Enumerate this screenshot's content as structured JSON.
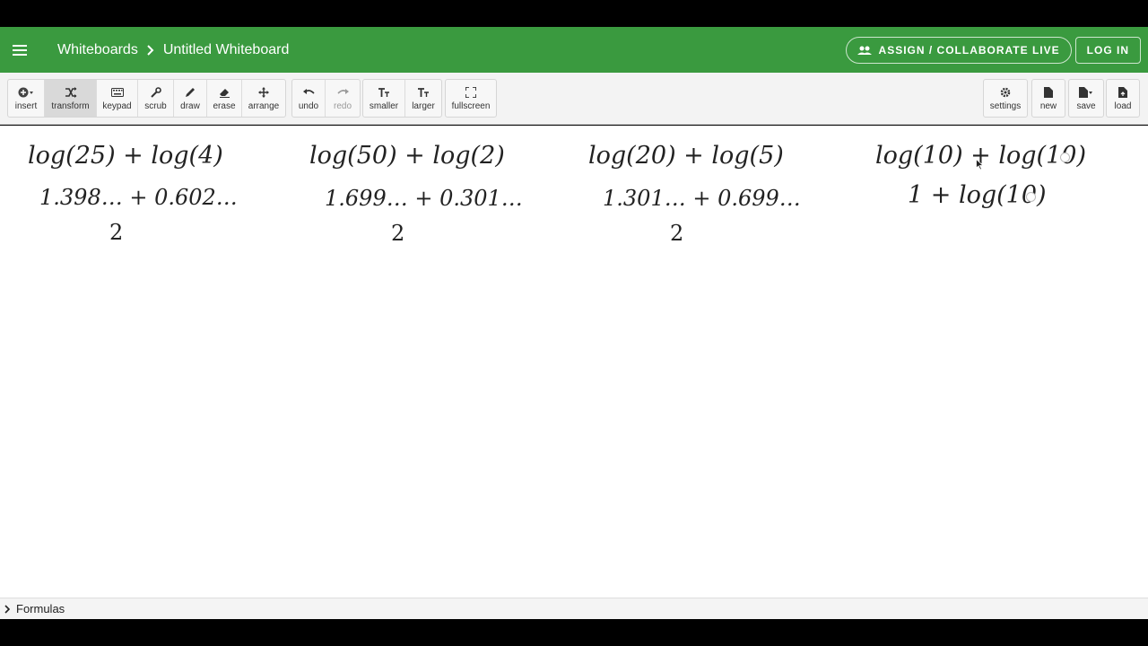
{
  "header": {
    "menu_icon": "hamburger-menu-icon",
    "breadcrumb_root": "Whiteboards",
    "breadcrumb_current": "Untitled Whiteboard",
    "assign_label": "ASSIGN / COLLABORATE LIVE",
    "login_label": "LOG IN",
    "bar_color": "#3a9a3f"
  },
  "toolbar": {
    "insert": "insert",
    "transform": "transform",
    "keypad": "keypad",
    "scrub": "scrub",
    "draw": "draw",
    "erase": "erase",
    "arrange": "arrange",
    "undo": "undo",
    "redo": "redo",
    "smaller": "smaller",
    "larger": "larger",
    "fullscreen": "fullscreen",
    "settings": "settings",
    "new": "new",
    "save": "save",
    "load": "load"
  },
  "whiteboard": {
    "columns": [
      {
        "line1": "log(25) + log(4)",
        "line2": "1.398… + 0.602…",
        "line3": "2"
      },
      {
        "line1": "log(50) + log(2)",
        "line2": "1.699… + 0.301…",
        "line3": "2"
      },
      {
        "line1": "log(20) + log(5)",
        "line2": "1.301… + 0.699…",
        "line3": "2"
      },
      {
        "line1": "log(10) + log(10)",
        "line2": "1 + log(10)"
      }
    ]
  },
  "footer": {
    "formulas_label": "Formulas"
  }
}
